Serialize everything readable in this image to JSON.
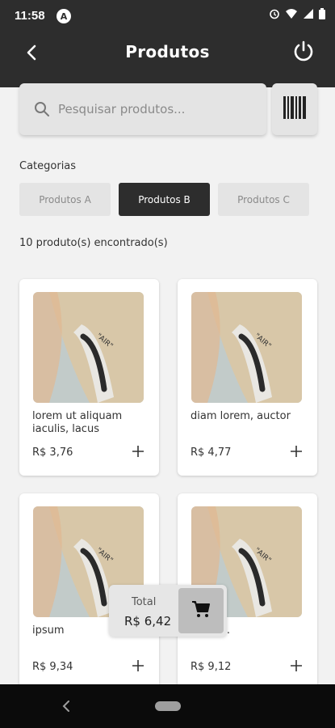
{
  "status_bar": {
    "time": "11:58",
    "app_badge": "A"
  },
  "appbar": {
    "title": "Produtos"
  },
  "search": {
    "placeholder": "Pesquisar produtos..."
  },
  "categories": {
    "label": "Categorias",
    "items": [
      {
        "label": "Produtos A",
        "active": false
      },
      {
        "label": "Produtos B",
        "active": true
      },
      {
        "label": "Produtos C",
        "active": false
      }
    ]
  },
  "results_count": "10 produto(s) encontrado(s)",
  "products": [
    {
      "name": "lorem ut aliquam iaculis, lacus",
      "price": "R$ 3,76"
    },
    {
      "name": "diam lorem, auctor",
      "price": "R$ 4,77"
    },
    {
      "name": "ipsum",
      "price": "R$ 9,34"
    },
    {
      "name": "...uada.",
      "price": "R$ 9,12"
    }
  ],
  "cart": {
    "total_label": "Total",
    "total_value": "R$ 6,42"
  },
  "colors": {
    "dark": "#2d2d2d",
    "surface": "#e4e4e4",
    "background": "#f2f2f2"
  },
  "icons": [
    "back-arrow-icon",
    "power-icon",
    "search-icon",
    "barcode-icon",
    "plus-icon",
    "cart-icon"
  ]
}
